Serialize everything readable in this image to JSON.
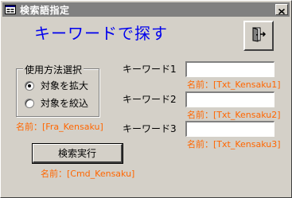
{
  "window": {
    "title": "検索語指定",
    "title_icon": "form-icon",
    "close_glyph": "✕"
  },
  "heading": "キーワードで探す",
  "exit_button": {
    "icon": "exit-door-icon"
  },
  "option_frame": {
    "legend": "使用方法選択",
    "options": [
      {
        "label": "対象を拡大",
        "checked": true
      },
      {
        "label": "対象を絞込",
        "checked": false
      }
    ],
    "name_label": "名前：[Fra_Kensaku]"
  },
  "keywords": [
    {
      "label": "キーワード1",
      "value": "",
      "name_label": "名前：[Txt_Kensaku1]"
    },
    {
      "label": "キーワード2",
      "value": "",
      "name_label": "名前：[Txt_Kensaku2]"
    },
    {
      "label": "キーワード3",
      "value": "",
      "name_label": "名前：[Txt_Kensaku3]"
    }
  ],
  "search_button": {
    "label": "検索実行",
    "name_label": "名前：[Cmd_Kensaku]"
  },
  "colors": {
    "heading": "#0000ee",
    "name_label": "#ff6600",
    "window_bg": "#d4d0c8",
    "titlebar_bg": "#808080"
  }
}
